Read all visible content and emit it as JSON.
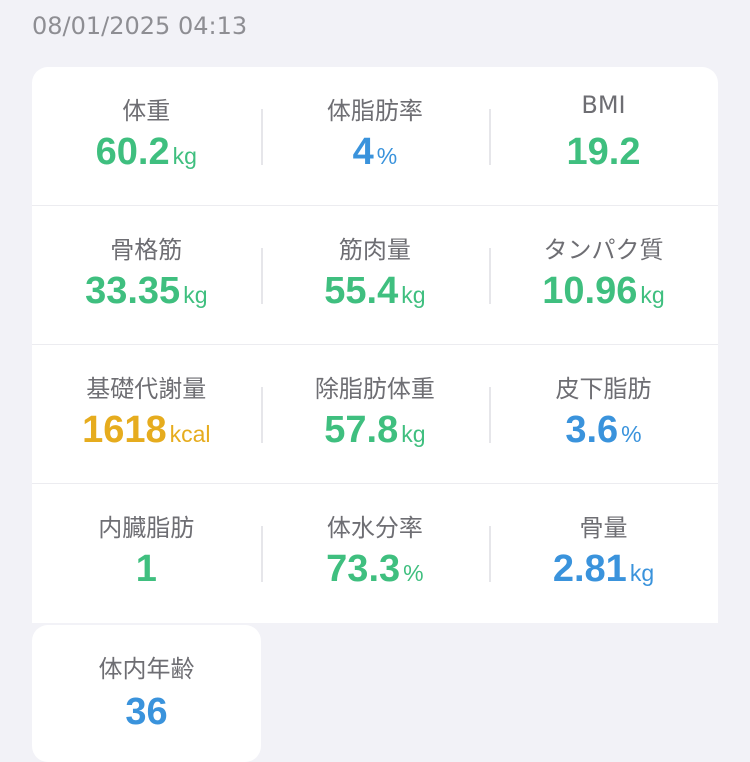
{
  "timestamp": "08/01/2025 04:13",
  "colors": {
    "green": "#3fbf7f",
    "blue": "#3a93dc",
    "amber": "#e6ac1e",
    "label": "#6e6e73",
    "timestamp": "#8e8e93"
  },
  "metrics": [
    {
      "label": "体重",
      "value": "60.2",
      "unit": "kg"
    },
    {
      "label": "体脂肪率",
      "value": "4",
      "unit": "%"
    },
    {
      "label": "BMI",
      "value": "19.2",
      "unit": ""
    },
    {
      "label": "骨格筋",
      "value": "33.35",
      "unit": "kg"
    },
    {
      "label": "筋肉量",
      "value": "55.4",
      "unit": "kg"
    },
    {
      "label": "タンパク質",
      "value": "10.96",
      "unit": "kg"
    },
    {
      "label": "基礎代謝量",
      "value": "1618",
      "unit": "kcal"
    },
    {
      "label": "除脂肪体重",
      "value": "57.8",
      "unit": "kg"
    },
    {
      "label": "皮下脂肪",
      "value": "3.6",
      "unit": "%"
    },
    {
      "label": "内臓脂肪",
      "value": "1",
      "unit": ""
    },
    {
      "label": "体水分率",
      "value": "73.3",
      "unit": "%"
    },
    {
      "label": "骨量",
      "value": "2.81",
      "unit": "kg"
    },
    {
      "label": "体内年齢",
      "value": "36",
      "unit": ""
    }
  ]
}
